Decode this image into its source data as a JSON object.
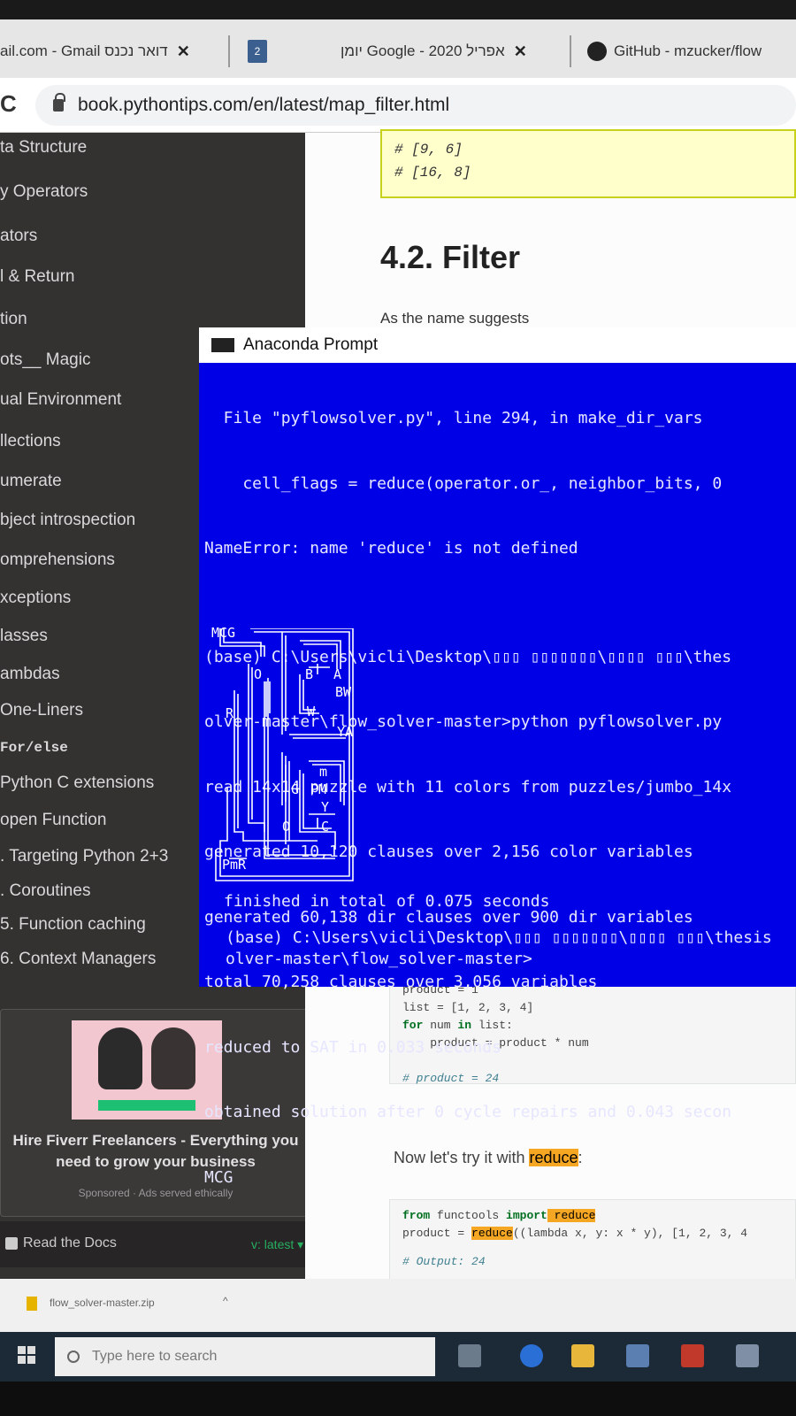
{
  "browser": {
    "tabs": [
      {
        "label": "ail.com - Gmail דואר נכנס",
        "close": "✕"
      },
      {
        "label": "2",
        "type": "calendar"
      },
      {
        "label": "יומן Google - אפריל 2020",
        "close": "✕"
      },
      {
        "label": "GitHub - mzucker/flow",
        "type": "github"
      }
    ],
    "reload_glyph": "C",
    "url": "book.pythontips.com/en/latest/map_filter.html"
  },
  "sidebar": {
    "items": [
      "ta Structure",
      "y Operators",
      "ators",
      "l & Return",
      "tion",
      "ots__ Magic",
      "ual Environment",
      "llections",
      "umerate",
      "bject introspection",
      "omprehensions",
      "xceptions",
      "lasses",
      "ambdas",
      "One-Liners",
      "For/else",
      "Python C extensions",
      "open Function",
      ". Targeting Python 2+3",
      ". Coroutines",
      "5. Function caching",
      "6. Context Managers"
    ],
    "ad": {
      "title_line1": "Hire Fiverr Freelancers - Everything you",
      "title_line2": "need to grow your business",
      "sponsored": "Sponsored · Ads served ethically"
    },
    "rtd_label": "Read the Docs",
    "version": "v: latest ▾"
  },
  "doc": {
    "code_top": [
      "# [9, 6]",
      "# [16, 8]"
    ],
    "heading": "4.2. Filter",
    "para_fragment": "As the name suggests",
    "code_product": {
      "l1": "product = 1",
      "l2": "list = [1, 2, 3, 4]",
      "l3_kw": "for",
      "l3_mid": " num ",
      "l3_kw2": "in",
      "l3_end": " list:",
      "l4": "    product = product * num",
      "l5": "# product = 24"
    },
    "para2_pre": "Now let's try it with ",
    "para2_hl": "reduce",
    "para2_post": ":",
    "code_reduce": {
      "kw1": "from",
      "mod": " functools ",
      "kw2": "import",
      "name": " reduce",
      "l2_pre": "product = ",
      "l2_hl": "reduce",
      "l2_post": "((lambda x, y: x * y), [1, 2, 3, 4",
      "l3": "# Output: 24"
    }
  },
  "terminal": {
    "title": "Anaconda Prompt",
    "lines": [
      "  File \"pyflowsolver.py\", line 294, in make_dir_vars",
      "    cell_flags = reduce(operator.or_, neighbor_bits, 0",
      "NameError: name 'reduce' is not defined",
      "",
      "(base) C:\\Users\\vicli\\Desktop\\▯▯▯ ▯▯▯▯▯▯▯\\▯▯▯▯ ▯▯▯\\thes",
      "olver-master\\flow_solver-master>python pyflowsolver.py",
      "read 14x14 puzzle with 11 colors from puzzles/jumbo_14x",
      "generated 10,120 clauses over 2,156 color variables",
      "generated 60,138 dir clauses over 900 dir variables",
      "total 70,258 clauses over 3,056 variables",
      "reduced to SAT in 0.033 seconds",
      "obtained solution after 0 cycle repairs and 0.043 secon",
      "MCG"
    ],
    "maze_labels": [
      "O",
      "B",
      "A",
      "BW",
      "R",
      "W",
      "YA",
      "m",
      "G",
      "PM",
      "Y",
      "O",
      "C",
      "PmR"
    ],
    "finished": "finished in total of 0.075 seconds",
    "prompt_line1": "(base) C:\\Users\\vicli\\Desktop\\▯▯▯ ▯▯▯▯▯▯▯\\▯▯▯▯ ▯▯▯\\thesis",
    "prompt_line2": "olver-master\\flow_solver-master>"
  },
  "downloads": {
    "file": "flow_solver-master.zip",
    "caret": "^"
  },
  "taskbar": {
    "search_placeholder": "Type here to search"
  }
}
